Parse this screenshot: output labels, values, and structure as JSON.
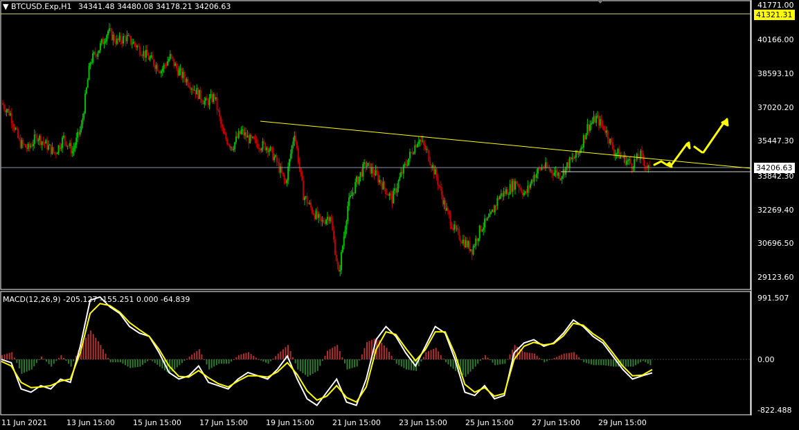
{
  "header": {
    "symbol": "BTCUSD.Exp,H1",
    "ohlc": "34341.48 34480.08 34178.21 34206.63",
    "macd_label": "MACD(12,26,9) -205.127 -155.251 0.000 -64.839"
  },
  "price_axis": {
    "labels": [
      "41771.00",
      "40166.00",
      "38593.10",
      "37020.20",
      "35447.30",
      "33842.30",
      "32269.40",
      "30696.50",
      "29123.60"
    ],
    "ask_line": "41321.31",
    "current_price": "34206.63"
  },
  "macd_axis": {
    "labels": [
      "991.507",
      "0.00",
      "-822.488"
    ]
  },
  "time_axis": {
    "labels": [
      "11 Jun 2021",
      "13 Jun 15:00",
      "15 Jun 15:00",
      "17 Jun 15:00",
      "19 Jun 15:00",
      "21 Jun 15:00",
      "23 Jun 15:00",
      "25 Jun 15:00",
      "27 Jun 15:00",
      "29 Jun 15:00"
    ]
  },
  "colors": {
    "background": "#000000",
    "bull": "#00c000",
    "bear": "#c00000",
    "trendline": "#ffff00",
    "grid_line": "#8899aa",
    "macd_line": "#ffffff",
    "signal_line": "#ffff00"
  },
  "chart_data": {
    "type": "candlestick",
    "title": "BTCUSD.Exp,H1",
    "ylim": [
      28800,
      41950
    ],
    "x": [
      "11 Jun 2021",
      "13 Jun 15:00",
      "15 Jun 15:00",
      "17 Jun 15:00",
      "19 Jun 15:00",
      "21 Jun 15:00",
      "23 Jun 15:00",
      "25 Jun 15:00",
      "27 Jun 15:00",
      "29 Jun 15:00"
    ],
    "close_series": [
      37300,
      36800,
      35500,
      35200,
      35800,
      35400,
      35000,
      35700,
      35100,
      36200,
      39200,
      39800,
      40600,
      40100,
      40300,
      40000,
      39600,
      39200,
      38800,
      39400,
      38700,
      38300,
      37800,
      37300,
      37600,
      35800,
      35300,
      36000,
      35600,
      35400,
      35300,
      34600,
      33600,
      36000,
      33100,
      32400,
      31800,
      32200,
      29400,
      32600,
      33700,
      34500,
      34100,
      33500,
      32900,
      34000,
      34900,
      35700,
      35000,
      33900,
      32500,
      31500,
      31000,
      30600,
      31600,
      32000,
      33000,
      33300,
      33700,
      33100,
      34000,
      34400,
      34200,
      34000,
      34600,
      35000,
      36200,
      36600,
      36100,
      35100,
      34800,
      34500,
      34900,
      34206
    ],
    "annotations": [
      "descending trendline from 19 Jun to 30 Jun",
      "horizontal support near 33900",
      "yellow projection arrows pointing up"
    ],
    "macd": {
      "ylim": [
        -822.488,
        991.507
      ],
      "macd_values": [
        0,
        -50,
        -450,
        -500,
        -400,
        -450,
        -300,
        -350,
        200,
        900,
        950,
        800,
        700,
        500,
        400,
        350,
        100,
        -200,
        -300,
        -250,
        -100,
        -350,
        -400,
        -450,
        -300,
        -200,
        -250,
        -300,
        -150,
        50,
        -300,
        -600,
        -700,
        -500,
        -300,
        -650,
        -700,
        -300,
        300,
        500,
        350,
        100,
        -100,
        200,
        500,
        400,
        0,
        -500,
        -550,
        -400,
        -600,
        -550,
        100,
        250,
        300,
        200,
        250,
        400,
        600,
        500,
        350,
        250,
        50,
        -150,
        -300,
        -250,
        -205
      ],
      "signal_values": [
        -30,
        -100,
        -350,
        -430,
        -420,
        -400,
        -330,
        -300,
        100,
        700,
        850,
        820,
        720,
        560,
        450,
        350,
        150,
        -100,
        -260,
        -270,
        -170,
        -280,
        -370,
        -420,
        -330,
        -250,
        -250,
        -270,
        -190,
        -50,
        -230,
        -480,
        -620,
        -560,
        -400,
        -580,
        -650,
        -420,
        150,
        420,
        380,
        170,
        -20,
        150,
        420,
        420,
        80,
        -380,
        -500,
        -430,
        -560,
        -520,
        0,
        200,
        260,
        220,
        240,
        360,
        550,
        520,
        390,
        290,
        100,
        -100,
        -250,
        -240,
        -155
      ]
    }
  }
}
